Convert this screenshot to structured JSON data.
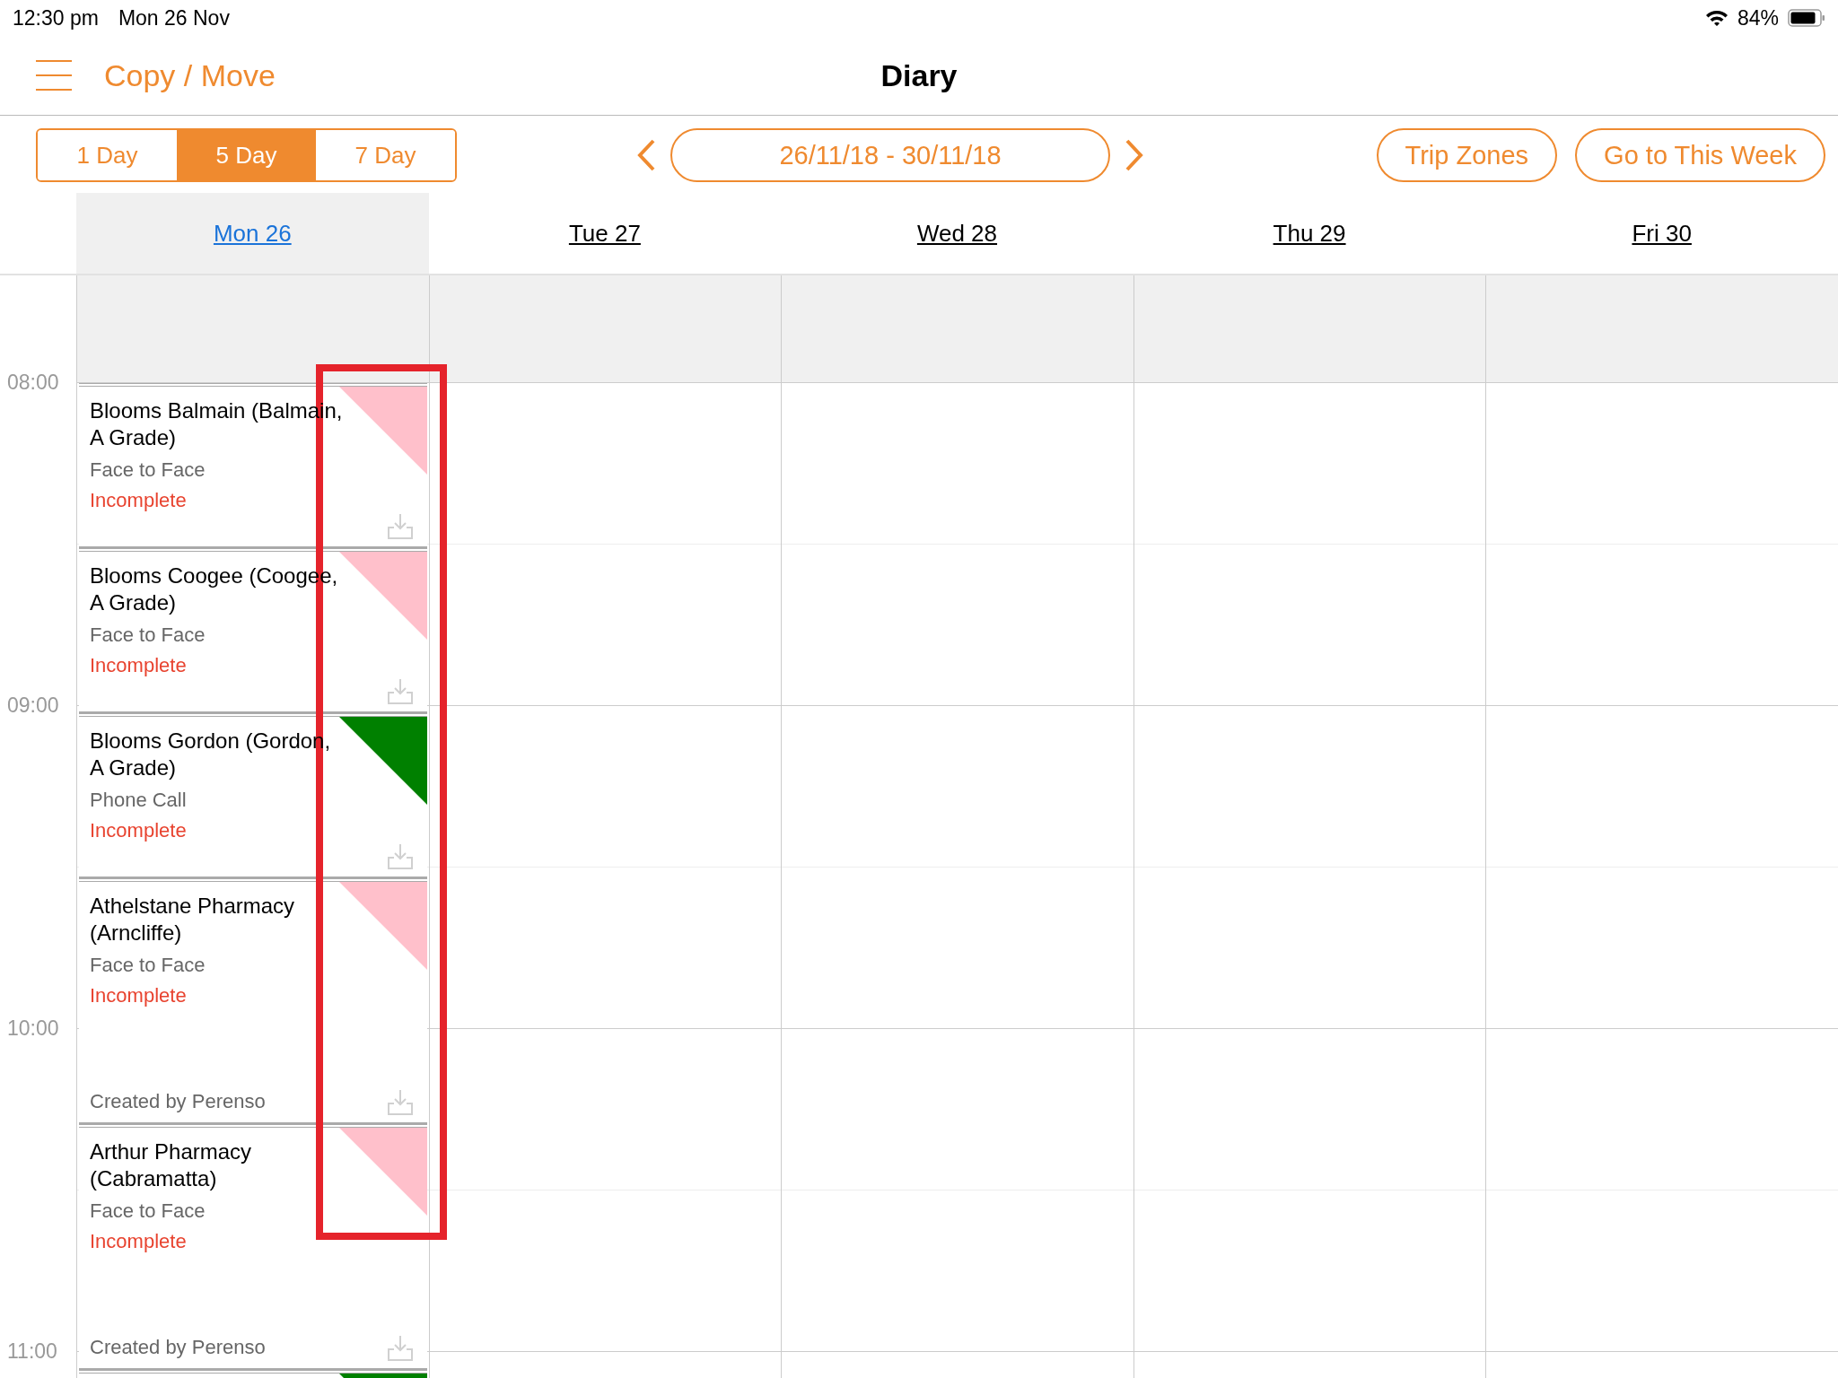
{
  "status_bar": {
    "time": "12:30 pm",
    "date": "Mon 26 Nov",
    "battery": "84%"
  },
  "nav": {
    "back_link": "Copy / Move",
    "title": "Diary"
  },
  "toolbar": {
    "views": [
      {
        "label": "1 Day",
        "selected": false
      },
      {
        "label": "5 Day",
        "selected": true
      },
      {
        "label": "7 Day",
        "selected": false
      }
    ],
    "date_range": "26/11/18 - 30/11/18",
    "actions": [
      "Trip Zones",
      "Go to This Week"
    ]
  },
  "times": [
    "08:00",
    "09:00",
    "10:00",
    "11:00"
  ],
  "days": [
    {
      "label": "Mon 26",
      "selected": true,
      "appointments": [
        {
          "title": "Blooms Balmain (Balmain, A Grade)",
          "type": "Face to Face",
          "status": "Incomplete",
          "color": "#ffc0cb"
        },
        {
          "title": "Blooms Coogee (Coogee, A Grade)",
          "type": "Face to Face",
          "status": "Incomplete",
          "color": "#ffc0cb"
        },
        {
          "title": "Blooms Gordon (Gordon, A Grade)",
          "type": "Phone Call",
          "status": "Incomplete",
          "color": "#008000"
        },
        {
          "title": "Athelstane Pharmacy (Arncliffe)",
          "type": "Face to Face",
          "status": "Incomplete",
          "created_by": "Created by Perenso",
          "color": "#ffc0cb"
        },
        {
          "title": "Arthur Pharmacy (Cabramatta)",
          "type": "Face to Face",
          "status": "Incomplete",
          "created_by": "Created by Perenso",
          "color": "#ffc0cb"
        },
        {
          "color": "#008000"
        }
      ]
    },
    {
      "label": "Tue 27",
      "selected": false
    },
    {
      "label": "Wed 28",
      "selected": false
    },
    {
      "label": "Thu 29",
      "selected": false
    },
    {
      "label": "Fri 30",
      "selected": false
    }
  ]
}
